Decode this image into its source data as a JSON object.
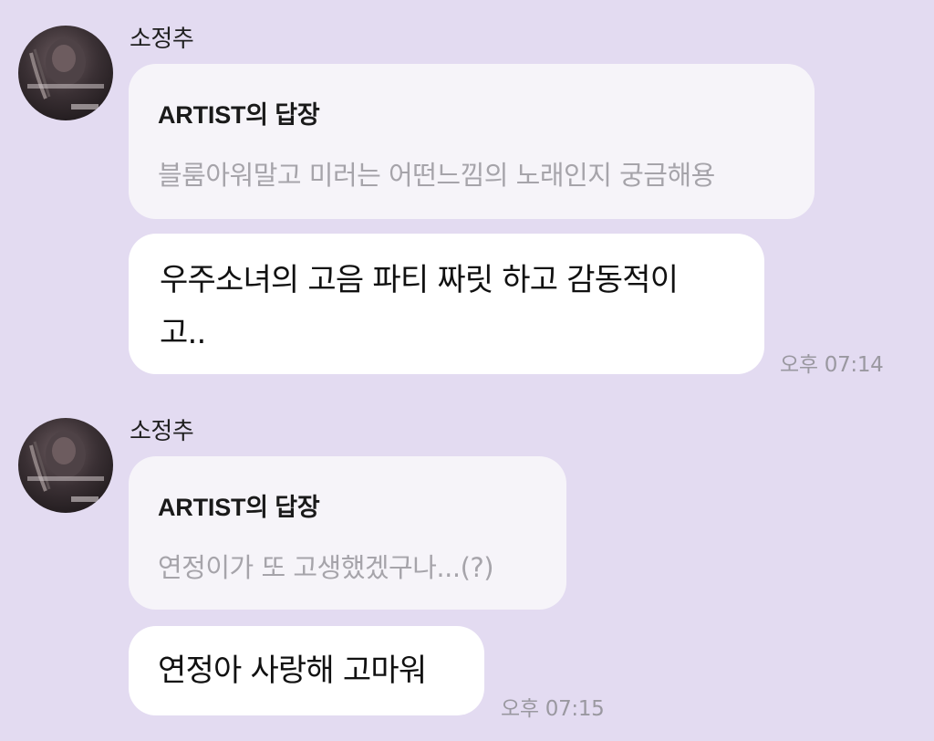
{
  "messages": [
    {
      "sender": "소정추",
      "reply_title": "ARTIST의 답장",
      "reply_body": "블룸아워말고 미러는 어떤느낌의 노래인지 궁금해용",
      "text_lines": [
        "우주소녀의 고음 파티 짜릿 하고 감동적이",
        "고.."
      ],
      "time": "오후 07:14"
    },
    {
      "sender": "소정추",
      "reply_title": "ARTIST의 답장",
      "reply_body": "연정이가 또 고생했겠구나...(?)",
      "text_lines": [
        "연정아 사랑해 고마워"
      ],
      "time": "오후 07:15"
    }
  ],
  "colors": {
    "background": "#e3dbf1",
    "reply_card": "#f6f4f9",
    "bubble": "#ffffff",
    "reply_text": "#a6a4aa",
    "timestamp": "#9a98a0"
  }
}
